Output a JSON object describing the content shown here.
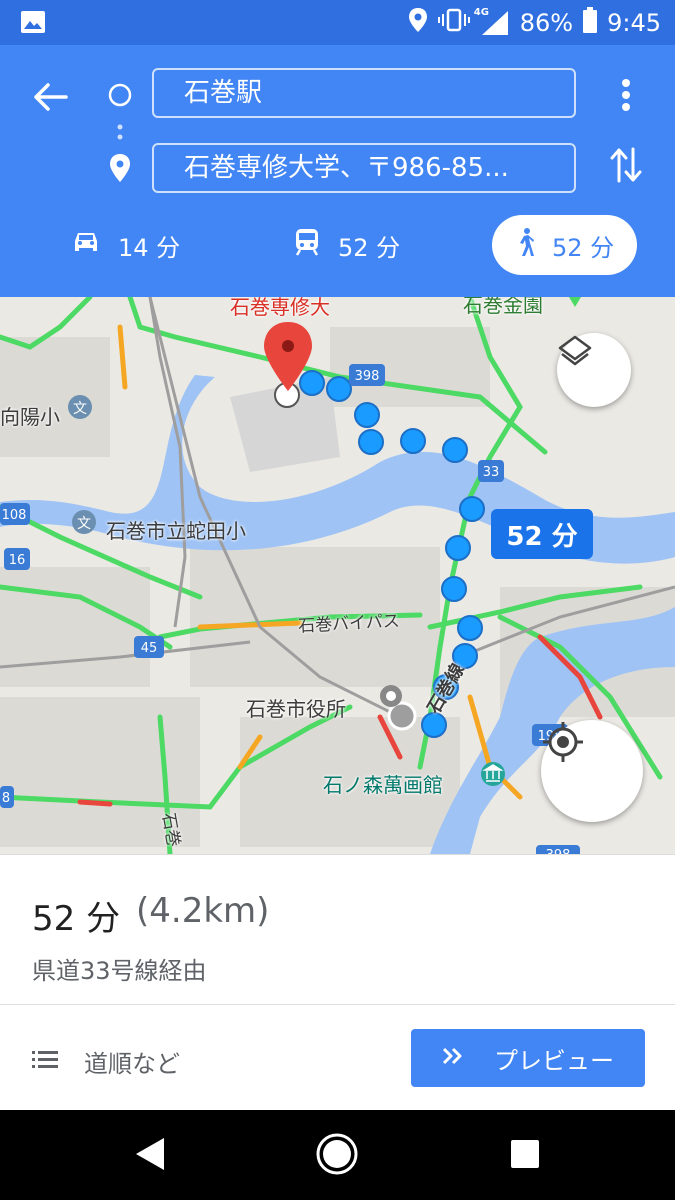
{
  "status_bar": {
    "network": "4G",
    "battery": "86%",
    "time": "9:45",
    "icons": [
      "image-icon",
      "location-icon",
      "vibrate-icon",
      "signal-icon",
      "battery-icon"
    ]
  },
  "directions": {
    "origin": "石巻駅",
    "destination": "石巻専修大学、〒986-85...",
    "modes": [
      {
        "name": "car",
        "icon": "car-icon",
        "time": "14 分"
      },
      {
        "name": "transit",
        "icon": "train-icon",
        "time": "52 分"
      },
      {
        "name": "walk",
        "icon": "walk-icon",
        "time": "52 分",
        "selected": true
      }
    ]
  },
  "map": {
    "route_badge": "52 分",
    "labels": {
      "university": "石巻専修大",
      "garden": "石巻金園",
      "school_yoshi": "向陽小",
      "school_hebita": "石巻市立蛇田小",
      "bypass": "石巻バイパス",
      "city_hall": "石巻市役所",
      "line": "石巻線",
      "museum": "石ノ森萬画館",
      "bottom_road": "石巻"
    },
    "route_shields": [
      "398",
      "33",
      "108",
      "16",
      "45",
      "198",
      "398",
      "8"
    ],
    "colors": {
      "water": "#9fc3f5",
      "route": "#1a9bff",
      "traffic_green": "#4cd964",
      "traffic_orange": "#f5a623",
      "traffic_red": "#e8453c"
    }
  },
  "summary": {
    "time": "52 分",
    "distance": "(4.2km)",
    "via": "県道33号線経由"
  },
  "actions": {
    "steps_label": "道順など",
    "preview_label": "プレビュー"
  },
  "accent_color": "#4285f4"
}
